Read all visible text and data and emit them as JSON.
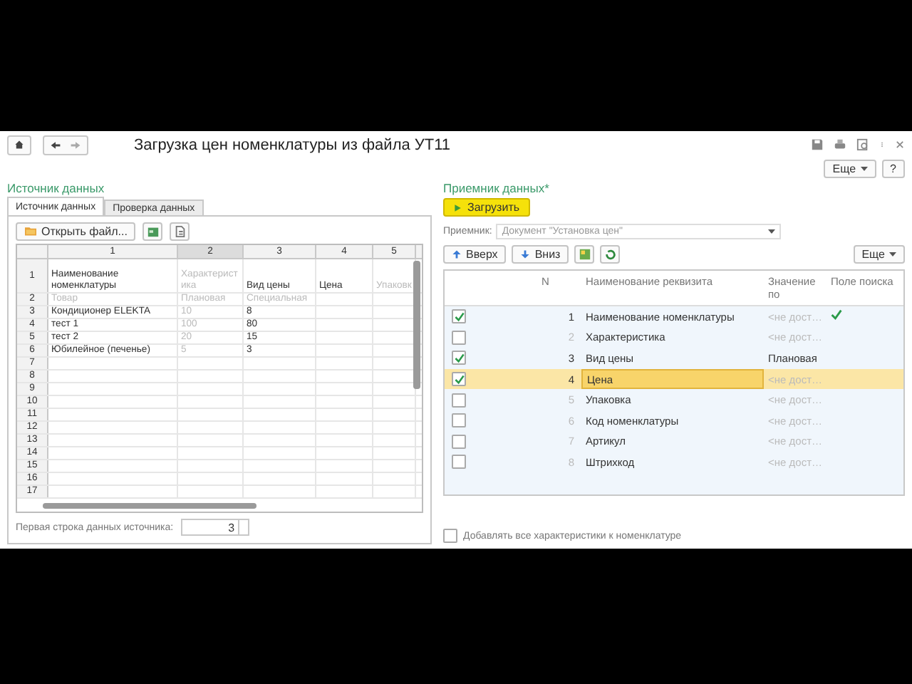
{
  "window": {
    "title": "Загрузка цен номенклатуры из файла УТ11"
  },
  "form_toolbar": {
    "more": "Еще",
    "help": "?"
  },
  "source": {
    "heading": "Источник данных",
    "tabs": [
      {
        "label": "Источник данных",
        "selected": true
      },
      {
        "label": "Проверка данных",
        "selected": false
      }
    ],
    "open_button": "Открыть файл...",
    "columns": [
      {
        "label": "1",
        "muted": false,
        "selected": false
      },
      {
        "label": "2",
        "muted": true,
        "selected": true
      },
      {
        "label": "3",
        "muted": false,
        "selected": false
      },
      {
        "label": "4",
        "muted": false,
        "selected": false
      },
      {
        "label": "5",
        "muted": true,
        "selected": false
      }
    ],
    "rows": [
      {
        "num": "1",
        "kind": "header",
        "cells": [
          "Наименование номенклатуры",
          "Характерист ика",
          "Вид цены",
          "Цена",
          "Упаковк"
        ]
      },
      {
        "num": "2",
        "kind": "sample",
        "cells": [
          "Товар",
          "Плановая",
          "Специальная"
        ]
      },
      {
        "num": "3",
        "kind": "data",
        "cells": [
          "Кондиционер ELEKTA",
          "10",
          "8"
        ]
      },
      {
        "num": "4",
        "kind": "data",
        "cells": [
          "тест 1",
          "100",
          "80"
        ]
      },
      {
        "num": "5",
        "kind": "data",
        "cells": [
          "тест 2",
          "20",
          "15"
        ]
      },
      {
        "num": "6",
        "kind": "data",
        "cells": [
          "Юбилейное (печенье)",
          "5",
          "3"
        ]
      },
      {
        "num": "7",
        "kind": "data",
        "cells": []
      },
      {
        "num": "8",
        "kind": "data",
        "cells": []
      },
      {
        "num": "9",
        "kind": "data",
        "cells": []
      },
      {
        "num": "10",
        "kind": "data",
        "cells": []
      },
      {
        "num": "11",
        "kind": "data",
        "cells": []
      },
      {
        "num": "12",
        "kind": "data",
        "cells": []
      },
      {
        "num": "13",
        "kind": "data",
        "cells": []
      },
      {
        "num": "14",
        "kind": "data",
        "cells": []
      },
      {
        "num": "15",
        "kind": "data",
        "cells": []
      },
      {
        "num": "16",
        "kind": "data",
        "cells": []
      },
      {
        "num": "17",
        "kind": "data",
        "cells": []
      }
    ],
    "first_row": {
      "label": "Первая строка данных источника:",
      "value": "3"
    }
  },
  "target": {
    "heading": "Приемник данных*",
    "load_button": "Загрузить",
    "receiver": {
      "label": "Приемник:",
      "value": "Документ \"Установка цен\"",
      "disabled": true
    },
    "up_button": "Вверх",
    "down_button": "Вниз",
    "more": "Еще",
    "columns": [
      "N",
      "Наименование реквизита",
      "Значение по",
      "Поле поиска"
    ],
    "rows": [
      {
        "checked": true,
        "n": "1",
        "name": "Наименование номенклатуры",
        "value": "<не дост…",
        "value_set": false,
        "search": true,
        "selected": false
      },
      {
        "checked": false,
        "n": "2",
        "name": "Характеристика",
        "value": "<не дост…",
        "value_set": false,
        "search": false,
        "selected": false
      },
      {
        "checked": true,
        "n": "3",
        "name": "Вид цены",
        "value": "Плановая",
        "value_set": true,
        "search": false,
        "selected": false
      },
      {
        "checked": true,
        "n": "4",
        "name": "Цена",
        "value": "<не дост…",
        "value_set": false,
        "search": false,
        "selected": true
      },
      {
        "checked": false,
        "n": "5",
        "name": "Упаковка",
        "value": "<не дост…",
        "value_set": false,
        "search": false,
        "selected": false
      },
      {
        "checked": false,
        "n": "6",
        "name": "Код номенклатуры",
        "value": "<не дост…",
        "value_set": false,
        "search": false,
        "selected": false
      },
      {
        "checked": false,
        "n": "7",
        "name": "Артикул",
        "value": "<не дост…",
        "value_set": false,
        "search": false,
        "selected": false
      },
      {
        "checked": false,
        "n": "8",
        "name": "Штрихкод",
        "value": "<не дост…",
        "value_set": false,
        "search": false,
        "selected": false
      }
    ],
    "add_all": {
      "label": "Добавлять все характеристики к номенклатуре",
      "checked": false
    }
  }
}
